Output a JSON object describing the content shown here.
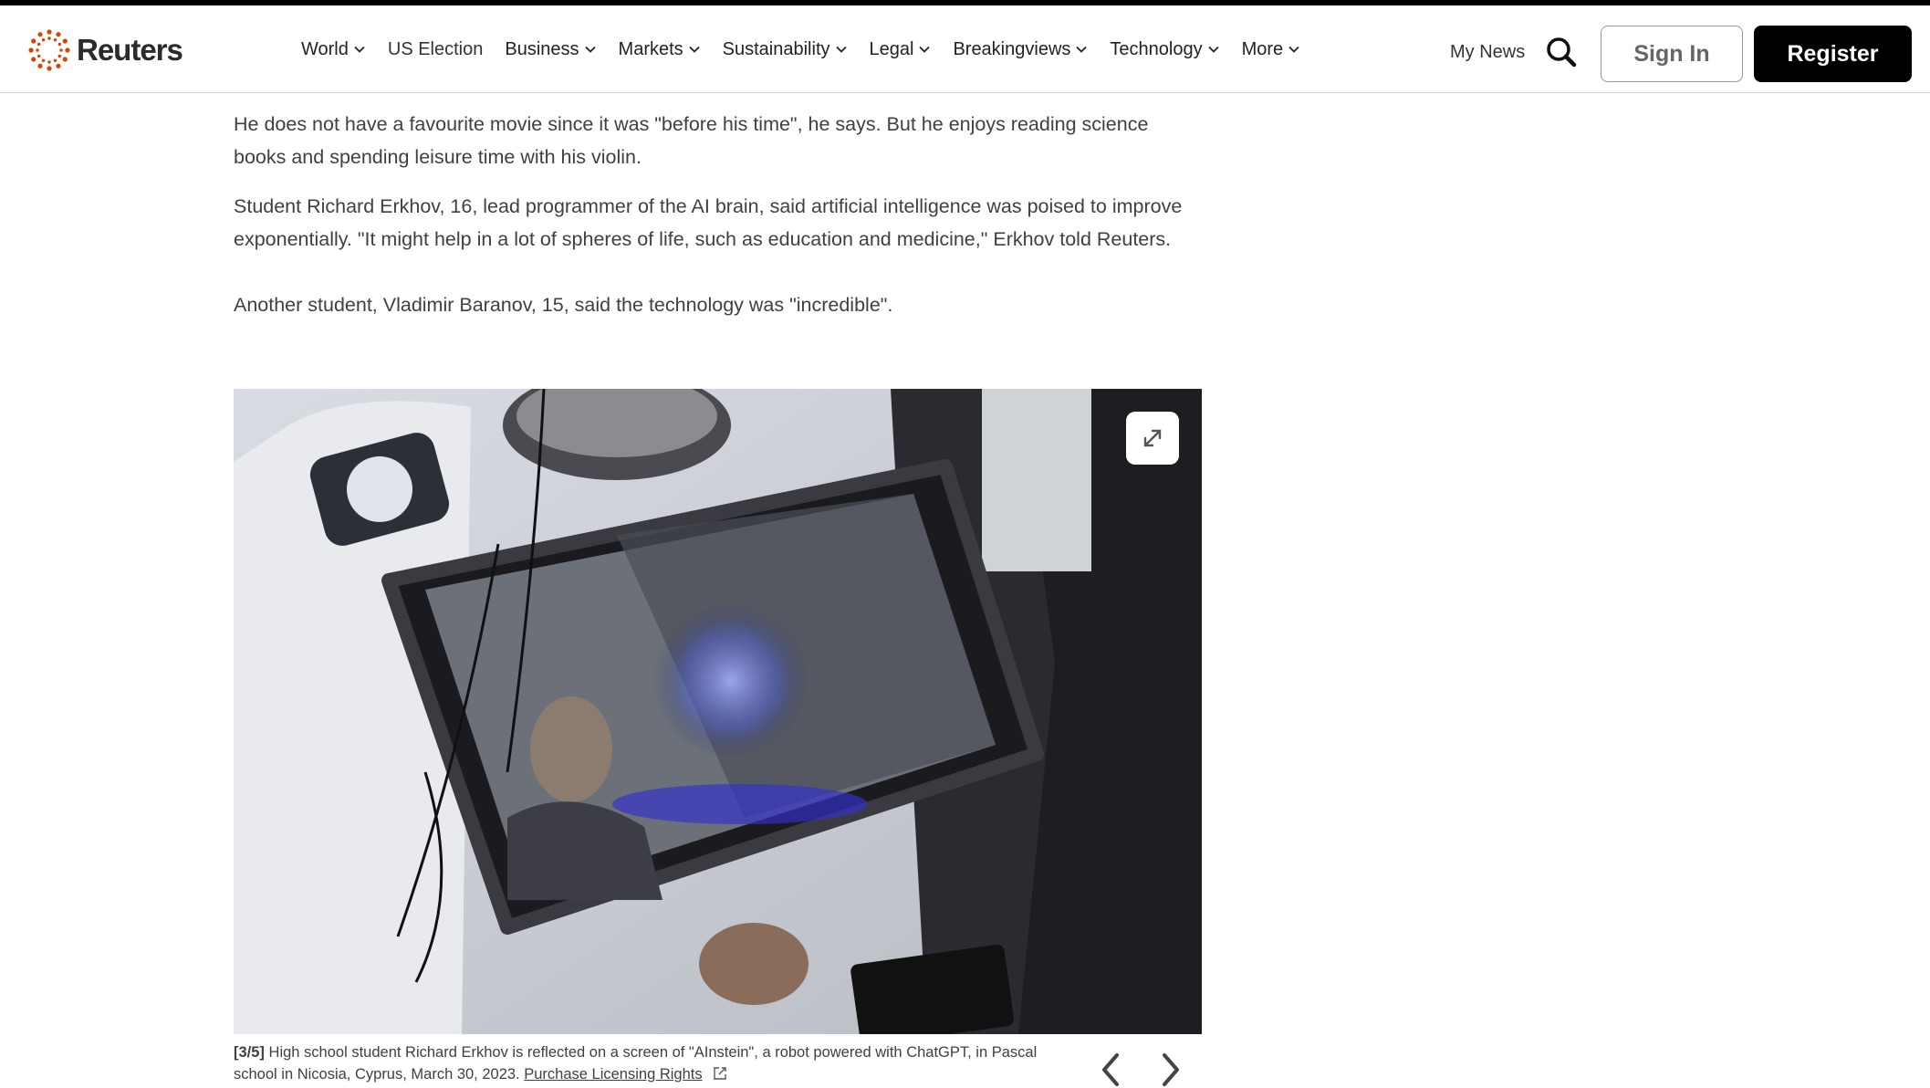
{
  "brand": {
    "name": "Reuters",
    "accent_color": "#dc4300"
  },
  "nav": {
    "items": [
      {
        "label": "World",
        "has_dropdown": true
      },
      {
        "label": "US Election",
        "has_dropdown": false
      },
      {
        "label": "Business",
        "has_dropdown": true
      },
      {
        "label": "Markets",
        "has_dropdown": true
      },
      {
        "label": "Sustainability",
        "has_dropdown": true
      },
      {
        "label": "Legal",
        "has_dropdown": true
      },
      {
        "label": "Breakingviews",
        "has_dropdown": true
      },
      {
        "label": "Technology",
        "has_dropdown": true
      },
      {
        "label": "More",
        "has_dropdown": true
      }
    ],
    "my_news": "My News",
    "search_icon": "search-icon",
    "sign_in": "Sign In",
    "register": "Register"
  },
  "article": {
    "paragraphs": [
      "He does not have a favourite movie since it was \"before his time\", he says. But he enjoys reading science books and spending leisure time with his violin.",
      "Student Richard Erkhov, 16, lead programmer of the AI brain, said artificial intelligence was poised to improve exponentially. \"It might help in a lot of spheres of life, such as education and medicine,\" Erkhov told Reuters.",
      "Another student, Vladimir Baranov, 15, said the technology was \"incredible\"."
    ]
  },
  "gallery": {
    "image_alt": "Robot with a tablet screen showing a glowing brain, reflecting a student's face",
    "expand_icon": "expand-icon",
    "counter": "[3/5]",
    "caption": "High school student Richard Erkhov is reflected on a screen of \"AInstein\", a robot powered with ChatGPT, in Pascal school in Nicosia, Cyprus, March 30, 2023.",
    "licensing_link": "Purchase Licensing Rights",
    "prev_icon": "chevron-left-icon",
    "next_icon": "chevron-right-icon"
  }
}
